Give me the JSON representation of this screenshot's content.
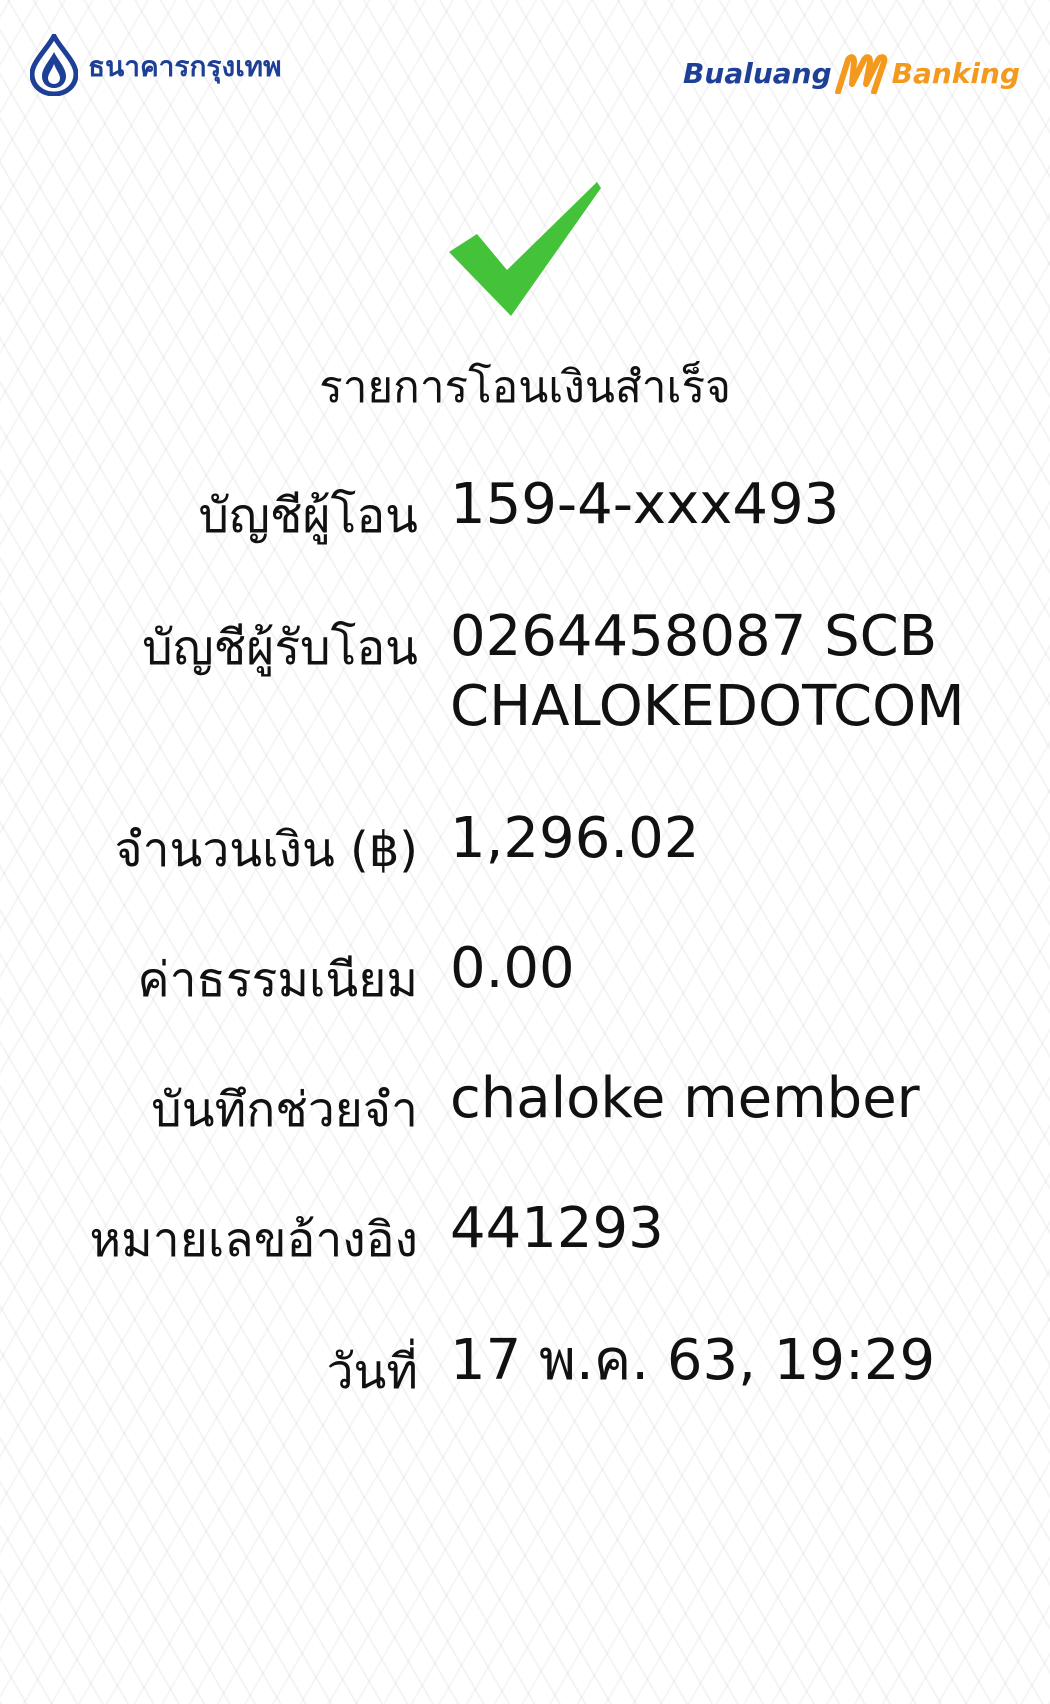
{
  "header": {
    "bank_name": "ธนาคารกรุงเทพ",
    "app_name_left": "Bualuang",
    "app_name_right": "Banking",
    "colors": {
      "brand_blue": "#1d3f95",
      "brand_orange": "#f39a1e",
      "success_green": "#43c23a"
    }
  },
  "status": {
    "icon": "check-icon",
    "title": "รายการโอนเงินสำเร็จ"
  },
  "details": {
    "from_account": {
      "label": "บัญชีผู้โอน",
      "value": "159-4-xxx493"
    },
    "to_account": {
      "label": "บัญชีผู้รับโอน",
      "value_line1": "0264458087 SCB",
      "value_line2": "CHALOKEDOTCOM"
    },
    "amount": {
      "label": "จำนวนเงิน (฿)",
      "value": "1,296.02"
    },
    "fee": {
      "label": "ค่าธรรมเนียม",
      "value": "0.00"
    },
    "memo": {
      "label": "บันทึกช่วยจำ",
      "value": "chaloke member"
    },
    "reference": {
      "label": "หมายเลขอ้างอิง",
      "value": "441293"
    },
    "date": {
      "label": "วันที่",
      "value": "17 พ.ค. 63, 19:29"
    }
  }
}
